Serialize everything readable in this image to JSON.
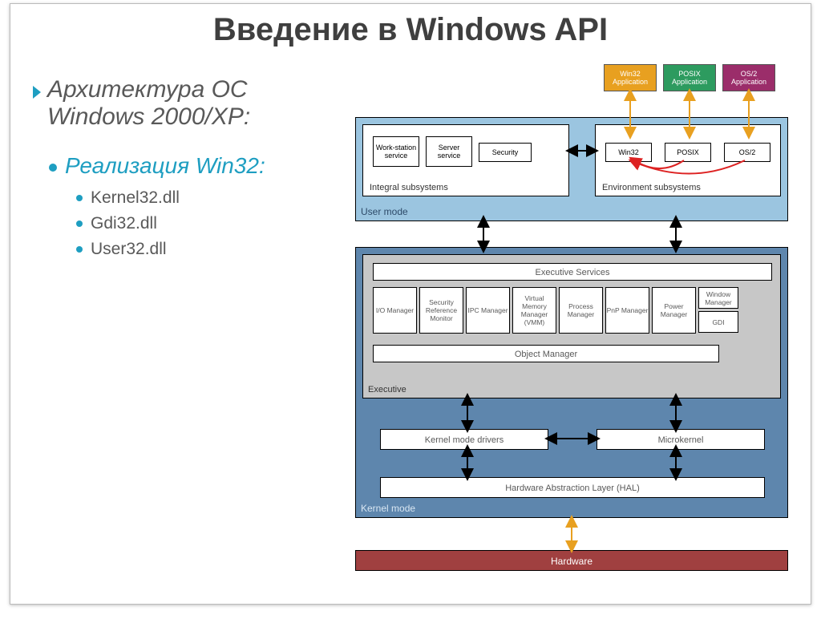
{
  "slide_title": "Введение в Windows API",
  "bullet1": "Архитектура ОС Windows 2000/XP:",
  "bullet2": "Реализация Win32:",
  "sub_bullets": [
    "Kernel32.dll",
    "Gdi32.dll",
    "User32.dll"
  ],
  "apps": [
    {
      "name": "Win32 Application",
      "color": "orange"
    },
    {
      "name": "POSIX Application",
      "color": "green"
    },
    {
      "name": "OS/2 Application",
      "color": "purple"
    }
  ],
  "user_mode_label": "User mode",
  "integral_subsystems_label": "Integral subsystems",
  "environment_subsystems_label": "Environment subsystems",
  "integral_boxes": [
    "Work-station service",
    "Server service",
    "Security"
  ],
  "env_boxes": [
    "Win32",
    "POSIX",
    "OS/2"
  ],
  "executive_label": "Executive",
  "exec_services_label": "Executive Services",
  "exec_boxes": [
    "I/O Manager",
    "Security Reference Monitor",
    "IPC Manager",
    "Virtual Memory Manager (VMM)",
    "Process Manager",
    "PnP Manager",
    "Power Manager"
  ],
  "wm_label": "Window Manager",
  "gdi_label": "GDI",
  "object_manager_label": "Object Manager",
  "km_drivers_label": "Kernel mode drivers",
  "microkernel_label": "Microkernel",
  "hal_label": "Hardware Abstraction Layer (HAL)",
  "kernel_mode_label": "Kernel mode",
  "hardware_label": "Hardware"
}
